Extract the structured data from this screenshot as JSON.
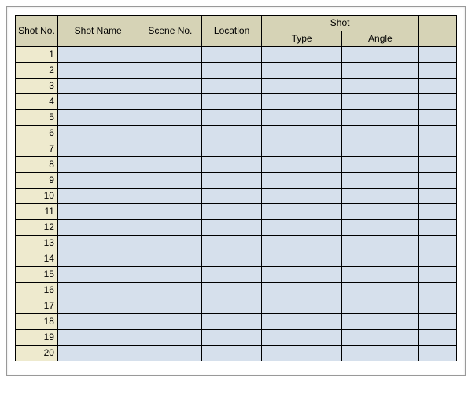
{
  "headers": {
    "shotNo": "Shot No.",
    "shotName": "Shot Name",
    "sceneNo": "Scene No.",
    "location": "Location",
    "shotGroup": "Shot",
    "type": "Type",
    "angle": "Angle",
    "extra": ""
  },
  "rows": [
    {
      "no": "1",
      "name": "",
      "scene": "",
      "loc": "",
      "type": "",
      "angle": "",
      "x": ""
    },
    {
      "no": "2",
      "name": "",
      "scene": "",
      "loc": "",
      "type": "",
      "angle": "",
      "x": ""
    },
    {
      "no": "3",
      "name": "",
      "scene": "",
      "loc": "",
      "type": "",
      "angle": "",
      "x": ""
    },
    {
      "no": "4",
      "name": "",
      "scene": "",
      "loc": "",
      "type": "",
      "angle": "",
      "x": ""
    },
    {
      "no": "5",
      "name": "",
      "scene": "",
      "loc": "",
      "type": "",
      "angle": "",
      "x": ""
    },
    {
      "no": "6",
      "name": "",
      "scene": "",
      "loc": "",
      "type": "",
      "angle": "",
      "x": ""
    },
    {
      "no": "7",
      "name": "",
      "scene": "",
      "loc": "",
      "type": "",
      "angle": "",
      "x": ""
    },
    {
      "no": "8",
      "name": "",
      "scene": "",
      "loc": "",
      "type": "",
      "angle": "",
      "x": ""
    },
    {
      "no": "9",
      "name": "",
      "scene": "",
      "loc": "",
      "type": "",
      "angle": "",
      "x": ""
    },
    {
      "no": "10",
      "name": "",
      "scene": "",
      "loc": "",
      "type": "",
      "angle": "",
      "x": ""
    },
    {
      "no": "11",
      "name": "",
      "scene": "",
      "loc": "",
      "type": "",
      "angle": "",
      "x": ""
    },
    {
      "no": "12",
      "name": "",
      "scene": "",
      "loc": "",
      "type": "",
      "angle": "",
      "x": ""
    },
    {
      "no": "13",
      "name": "",
      "scene": "",
      "loc": "",
      "type": "",
      "angle": "",
      "x": ""
    },
    {
      "no": "14",
      "name": "",
      "scene": "",
      "loc": "",
      "type": "",
      "angle": "",
      "x": ""
    },
    {
      "no": "15",
      "name": "",
      "scene": "",
      "loc": "",
      "type": "",
      "angle": "",
      "x": ""
    },
    {
      "no": "16",
      "name": "",
      "scene": "",
      "loc": "",
      "type": "",
      "angle": "",
      "x": ""
    },
    {
      "no": "17",
      "name": "",
      "scene": "",
      "loc": "",
      "type": "",
      "angle": "",
      "x": ""
    },
    {
      "no": "18",
      "name": "",
      "scene": "",
      "loc": "",
      "type": "",
      "angle": "",
      "x": ""
    },
    {
      "no": "19",
      "name": "",
      "scene": "",
      "loc": "",
      "type": "",
      "angle": "",
      "x": ""
    },
    {
      "no": "20",
      "name": "",
      "scene": "",
      "loc": "",
      "type": "",
      "angle": "",
      "x": ""
    }
  ]
}
